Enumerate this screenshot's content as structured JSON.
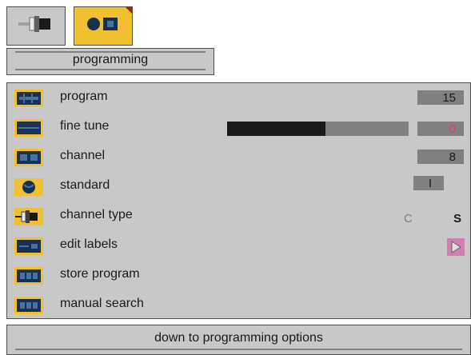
{
  "tabs": [
    {
      "name": "connection",
      "icon": "scart-connector-icon",
      "active": false
    },
    {
      "name": "tv",
      "icon": "tv-set-icon",
      "active": true
    }
  ],
  "menu": {
    "title": "programming"
  },
  "rows": [
    {
      "label": "program",
      "icon": "program-icon",
      "value": "15"
    },
    {
      "label": "fine tune",
      "icon": "fine-tune-icon",
      "value": "0",
      "level_percent": 54
    },
    {
      "label": "channel",
      "icon": "channel-icon",
      "value": "8"
    },
    {
      "label": "standard",
      "icon": "standard-icon",
      "value": "I"
    },
    {
      "label": "channel type",
      "icon": "channel-type-icon",
      "options": [
        "C",
        "S"
      ],
      "selected": "S"
    },
    {
      "label": "edit labels",
      "icon": "edit-labels-icon",
      "action_icon": "right-arrow-icon"
    },
    {
      "label": "store program",
      "icon": "store-program-icon"
    },
    {
      "label": "manual search",
      "icon": "manual-search-icon"
    }
  ],
  "footer": {
    "text": "down to programming options"
  },
  "colors": {
    "accent": "#f0c030",
    "panel": "#c8c8c8",
    "value_box": "#808080",
    "fine_tune_value": "#d04080"
  }
}
